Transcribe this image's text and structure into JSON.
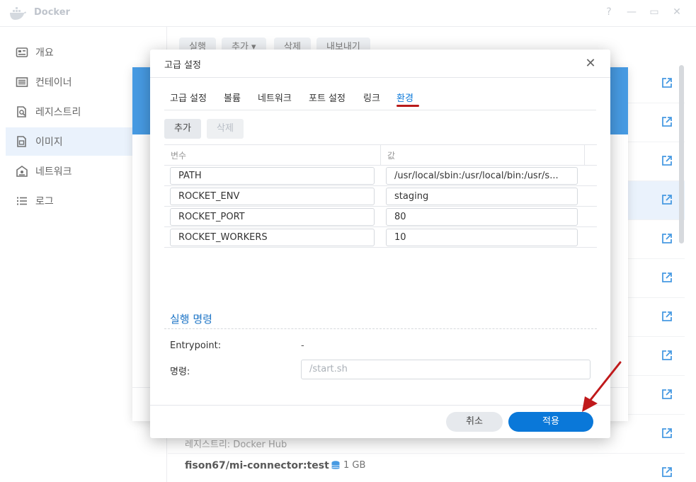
{
  "app": {
    "title": "Docker",
    "controls": {
      "help": "?",
      "minimize": "—",
      "maximize": "▭",
      "close": "✕"
    }
  },
  "sidebar": {
    "items": [
      {
        "label": "개요",
        "icon": "overview-icon",
        "active": false
      },
      {
        "label": "컨테이너",
        "icon": "container-icon",
        "active": false
      },
      {
        "label": "레지스트리",
        "icon": "registry-icon",
        "active": false
      },
      {
        "label": "이미지",
        "icon": "image-icon",
        "active": true
      },
      {
        "label": "네트워크",
        "icon": "network-icon",
        "active": false
      },
      {
        "label": "로그",
        "icon": "log-icon",
        "active": false
      }
    ]
  },
  "toolbar": {
    "run": "실행",
    "add": "추가 ▾",
    "delete": "삭제",
    "export": "내보내기"
  },
  "image_list": {
    "registry_text": "레지스트리: Docker Hub",
    "item_name": "fison67/mi-connector:test",
    "item_size": "1 GB"
  },
  "dialog": {
    "title": "고급 설정",
    "close": "✕",
    "tabs": [
      {
        "label": "고급 설정",
        "active": false
      },
      {
        "label": "볼륨",
        "active": false
      },
      {
        "label": "네트워크",
        "active": false
      },
      {
        "label": "포트 설정",
        "active": false
      },
      {
        "label": "링크",
        "active": false
      },
      {
        "label": "환경",
        "active": true
      }
    ],
    "add_button": "추가",
    "delete_button": "삭제",
    "table": {
      "columns": [
        "변수",
        "값"
      ],
      "rows": [
        {
          "variable": "PATH",
          "value": "/usr/local/sbin:/usr/local/bin:/usr/s..."
        },
        {
          "variable": "ROCKET_ENV",
          "value": "staging"
        },
        {
          "variable": "ROCKET_PORT",
          "value": "80"
        },
        {
          "variable": "ROCKET_WORKERS",
          "value": "10"
        }
      ]
    },
    "exec_section": {
      "title": "실행 명령",
      "entrypoint_label": "Entrypoint:",
      "entrypoint_value": "-",
      "command_label": "명령:",
      "command_placeholder": "/start.sh"
    },
    "cancel_button": "취소",
    "apply_button": "적용"
  },
  "colors": {
    "accent": "#0a78d9",
    "active_tab_underline": "#b81a1a",
    "annotation_arrow": "#c0191b",
    "section_title": "#1f76c7"
  }
}
